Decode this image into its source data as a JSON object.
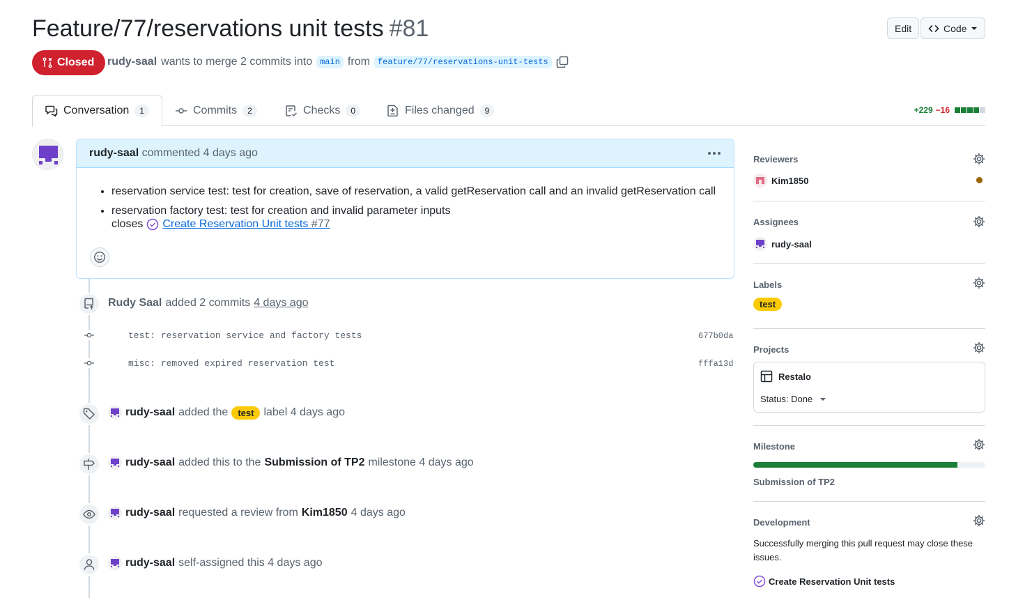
{
  "header": {
    "title": "Feature/77/reservations unit tests",
    "number": "#81",
    "edit_label": "Edit",
    "code_label": "Code"
  },
  "status": {
    "state_label": "Closed",
    "author": "rudy-saal",
    "merge_text": "wants to merge 2 commits into",
    "base_branch": "main",
    "from_text": "from",
    "head_branch": "feature/77/reservations-unit-tests"
  },
  "tabs": [
    {
      "label": "Conversation",
      "count": "1"
    },
    {
      "label": "Commits",
      "count": "2"
    },
    {
      "label": "Checks",
      "count": "0"
    },
    {
      "label": "Files changed",
      "count": "9"
    }
  ],
  "diffstat": {
    "additions": "+229",
    "deletions": "−16"
  },
  "comment": {
    "author": "rudy-saal",
    "meta": "commented 4 days ago",
    "bullets": [
      "reservation service test: test for creation, save of reservation, a valid getReservation call and an invalid getReservation call",
      "reservation factory test: test for creation and invalid parameter inputs"
    ],
    "closes_label": "closes",
    "issue_title": "Create Reservation Unit tests",
    "issue_number": "#77"
  },
  "timeline": {
    "commits_event": {
      "author": "Rudy Saal",
      "text": "added 2 commits",
      "time": "4 days ago"
    },
    "commits": [
      {
        "message": "test: reservation service and factory tests",
        "sha": "677b0da"
      },
      {
        "message": "misc: removed expired reservation test",
        "sha": "fffa13d"
      }
    ],
    "label_event": {
      "author": "rudy-saal",
      "pre": "added the",
      "label": "test",
      "post": "label 4 days ago"
    },
    "milestone_event": {
      "author": "rudy-saal",
      "pre": "added this to the",
      "milestone": "Submission of TP2",
      "post": "milestone 4 days ago"
    },
    "review_event": {
      "author": "rudy-saal",
      "pre": "requested a review from",
      "reviewer": "Kim1850",
      "post": "4 days ago"
    },
    "assign_event": {
      "author": "rudy-saal",
      "text": "self-assigned this 4 days ago"
    }
  },
  "sidebar": {
    "reviewers": {
      "title": "Reviewers",
      "name": "Kim1850"
    },
    "assignees": {
      "title": "Assignees",
      "name": "rudy-saal"
    },
    "labels": {
      "title": "Labels",
      "label": "test"
    },
    "projects": {
      "title": "Projects",
      "project": "Restalo",
      "status": "Status: Done"
    },
    "milestone": {
      "title": "Milestone",
      "name": "Submission of TP2",
      "progress": 0.88
    },
    "development": {
      "title": "Development",
      "text": "Successfully merging this pull request may close these issues.",
      "issue": "Create Reservation Unit tests"
    }
  },
  "colors": {
    "closed": "#cf222e",
    "accent": "#0969da",
    "label_test": "#fbca04",
    "progress": "#1a7f37",
    "avatar_purple": "#6e40c9"
  }
}
